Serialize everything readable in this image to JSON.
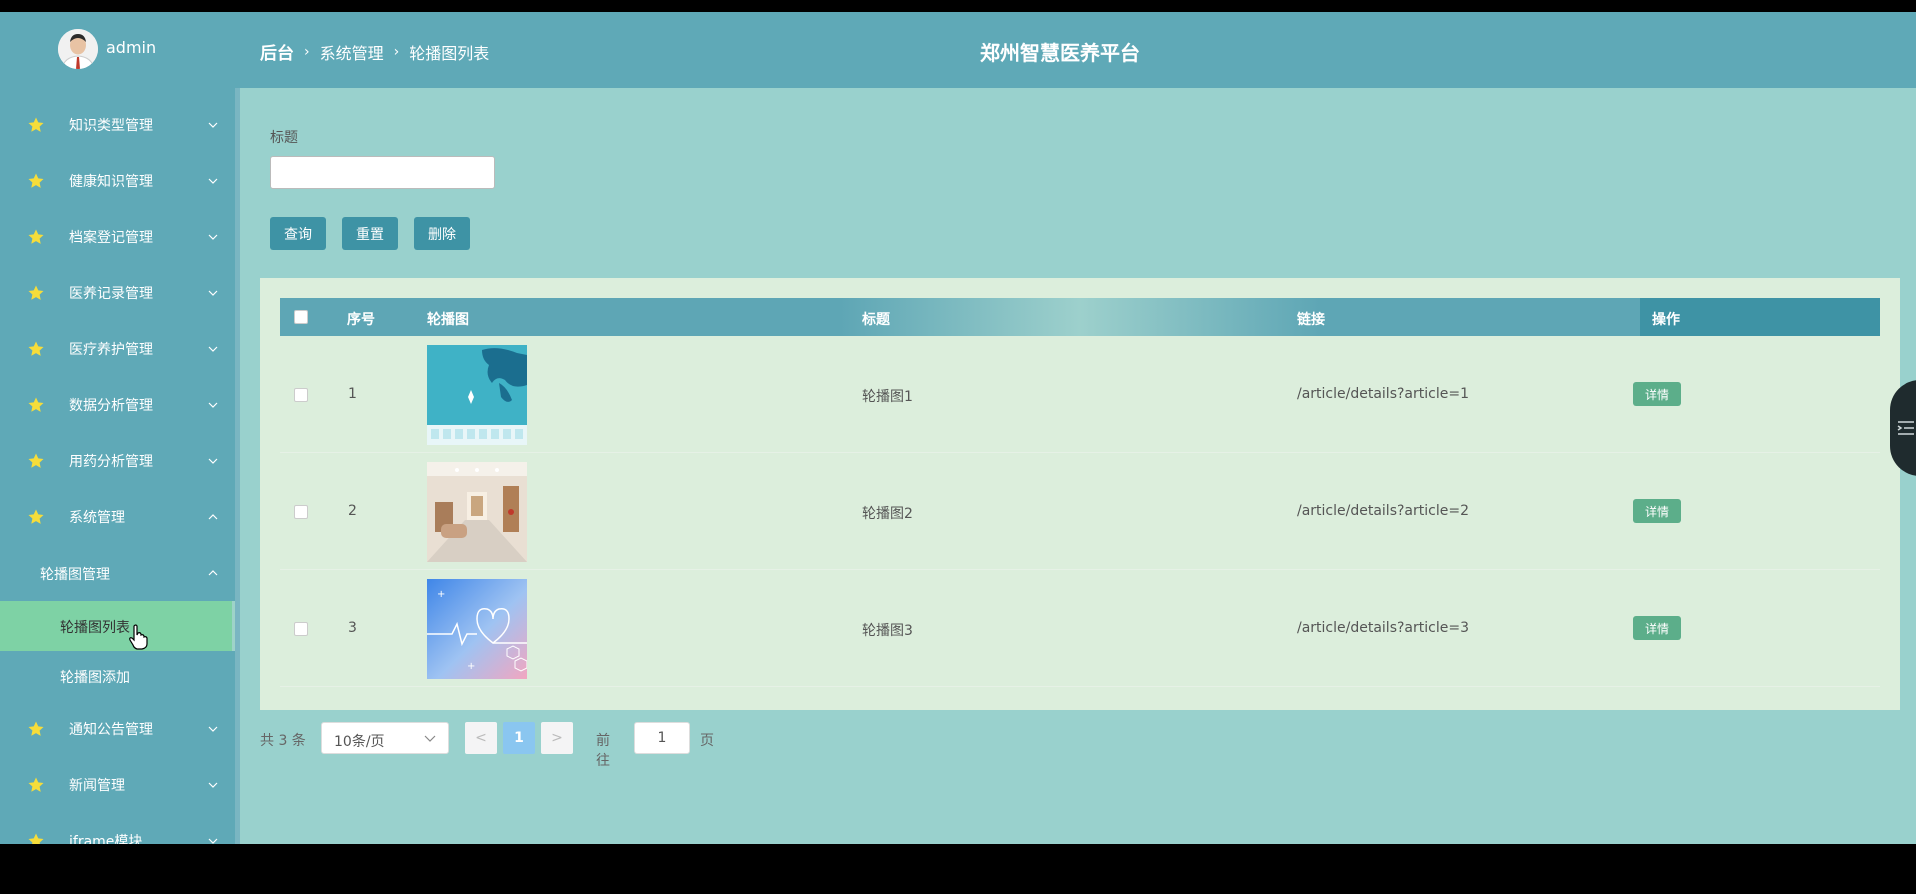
{
  "app": {
    "username": "admin",
    "site_title": "郑州智慧医养平台"
  },
  "breadcrumb": [
    "后台",
    "系统管理",
    "轮播图列表"
  ],
  "sidebar": {
    "items": [
      {
        "label": "知识类型管理",
        "icon": "star-icon"
      },
      {
        "label": "健康知识管理",
        "icon": "star-icon"
      },
      {
        "label": "档案登记管理",
        "icon": "star-icon"
      },
      {
        "label": "医养记录管理",
        "icon": "star-icon"
      },
      {
        "label": "医疗养护管理",
        "icon": "star-icon"
      },
      {
        "label": "数据分析管理",
        "icon": "star-icon"
      },
      {
        "label": "用药分析管理",
        "icon": "star-icon"
      },
      {
        "label": "系统管理",
        "icon": "star-icon"
      }
    ],
    "submenu_title": "轮播图管理",
    "sub_items": [
      "轮播图列表",
      "轮播图添加"
    ],
    "active_sub": "轮播图列表",
    "items_after": [
      {
        "label": "通知公告管理",
        "icon": "star-icon"
      },
      {
        "label": "新闻管理",
        "icon": "star-icon"
      },
      {
        "label": "iframe模块",
        "icon": "star-icon"
      }
    ]
  },
  "search": {
    "label": "标题",
    "value": "",
    "buttons": {
      "query": "查询",
      "reset": "重置",
      "delete": "删除"
    }
  },
  "table": {
    "headers": [
      "序号",
      "轮播图",
      "标题",
      "链接",
      "操作"
    ],
    "rows": [
      {
        "index": "1",
        "title": "轮播图1",
        "link": "/article/details?article=1",
        "action": "详情",
        "image": "world-map-banner"
      },
      {
        "index": "2",
        "title": "轮播图2",
        "link": "/article/details?article=2",
        "action": "详情",
        "image": "hospital-corridor"
      },
      {
        "index": "3",
        "title": "轮播图3",
        "link": "/article/details?article=3",
        "action": "详情",
        "image": "medical-heart-banner"
      }
    ]
  },
  "pagination": {
    "total": "共 3 条",
    "page_size": "10条/页",
    "prev": "<",
    "current": "1",
    "next": ">",
    "goto_label": "前往",
    "goto_value": "1",
    "page_suffix": "页"
  },
  "colors": {
    "sidebar": "#5fa9b7",
    "content_bg": "#99d1cd",
    "panel_bg": "#dceedc",
    "button": "#3e93a5",
    "detail_button": "#5cae8a",
    "active_item": "#7ed2a5",
    "current_page": "#8ac6f0"
  }
}
